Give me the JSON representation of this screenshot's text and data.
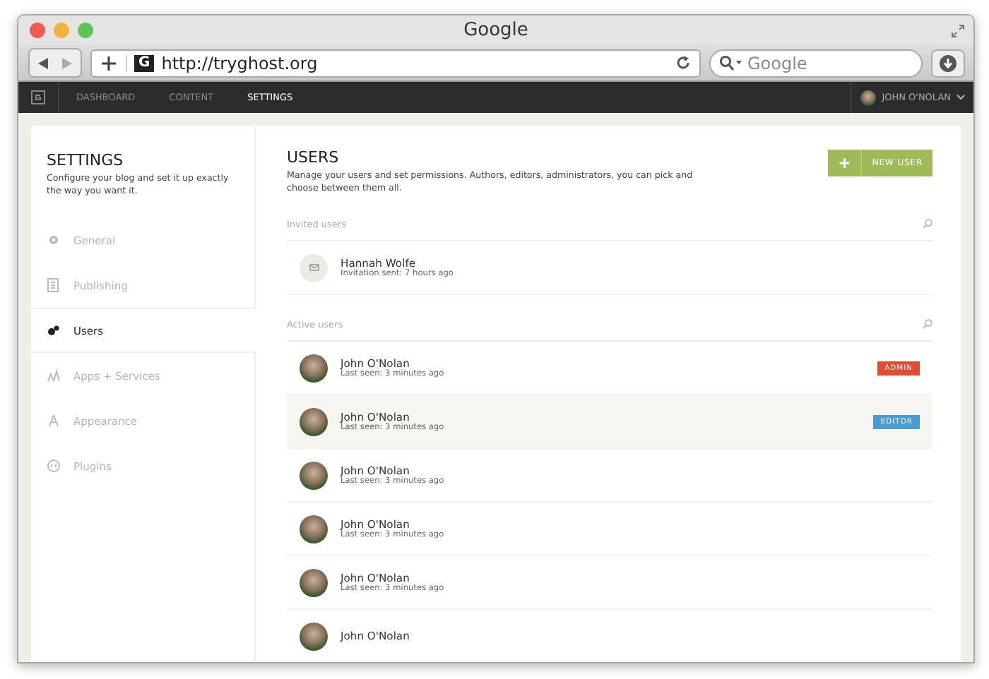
{
  "window": {
    "title": "Google"
  },
  "toolbar": {
    "url": "http://tryghost.org",
    "site_letter": "G",
    "search": {
      "placeholder": "Google"
    }
  },
  "nav": {
    "tabs": [
      {
        "label": "DASHBOARD",
        "selected": false
      },
      {
        "label": "CONTENT",
        "selected": false
      },
      {
        "label": "SETTINGS",
        "selected": true
      }
    ],
    "user": "JOHN O'NOLAN"
  },
  "sidebar": {
    "title": "SETTINGS",
    "description": "Configure your blog and set it up exactly the way you want it.",
    "items": [
      {
        "label": "General",
        "kind": "gear",
        "selected": false
      },
      {
        "label": "Publishing",
        "kind": "doc",
        "selected": false
      },
      {
        "label": "Users",
        "kind": "users",
        "selected": true
      },
      {
        "label": "Apps + Services",
        "kind": "apps",
        "selected": false
      },
      {
        "label": "Appearance",
        "kind": "brush",
        "selected": false
      },
      {
        "label": "Plugins",
        "kind": "plug",
        "selected": false
      }
    ]
  },
  "main": {
    "title": "USERS",
    "description": "Manage your users and set permissions. Authors, editors, administrators, you can pick and choose between them all.",
    "new_button": {
      "icon": "+",
      "label": "NEW USER"
    },
    "invited": {
      "heading": "Invited users",
      "users": [
        {
          "name": "Hannah Wolfe",
          "status": "Invitation sent: 7 hours ago"
        }
      ]
    },
    "active": {
      "heading": "Active users",
      "users": [
        {
          "name": "John O'Nolan",
          "status": "Last seen: 3 minutes ago",
          "hovered": false,
          "role": {
            "label": "ADMIN",
            "color": "#e04b34"
          }
        },
        {
          "name": "John O'Nolan",
          "status": "Last seen: 3 minutes ago",
          "hovered": true,
          "role": {
            "label": "EDITOR",
            "color": "#4a9bd4"
          }
        },
        {
          "name": "John O'Nolan",
          "status": "Last seen: 3 minutes ago",
          "hovered": false
        },
        {
          "name": "John O'Nolan",
          "status": "Last seen: 3 minutes ago",
          "hovered": false
        },
        {
          "name": "John O'Nolan",
          "status": "Last seen: 3 minutes ago",
          "hovered": false
        },
        {
          "name": "John O'Nolan",
          "hovered": false
        }
      ]
    }
  }
}
